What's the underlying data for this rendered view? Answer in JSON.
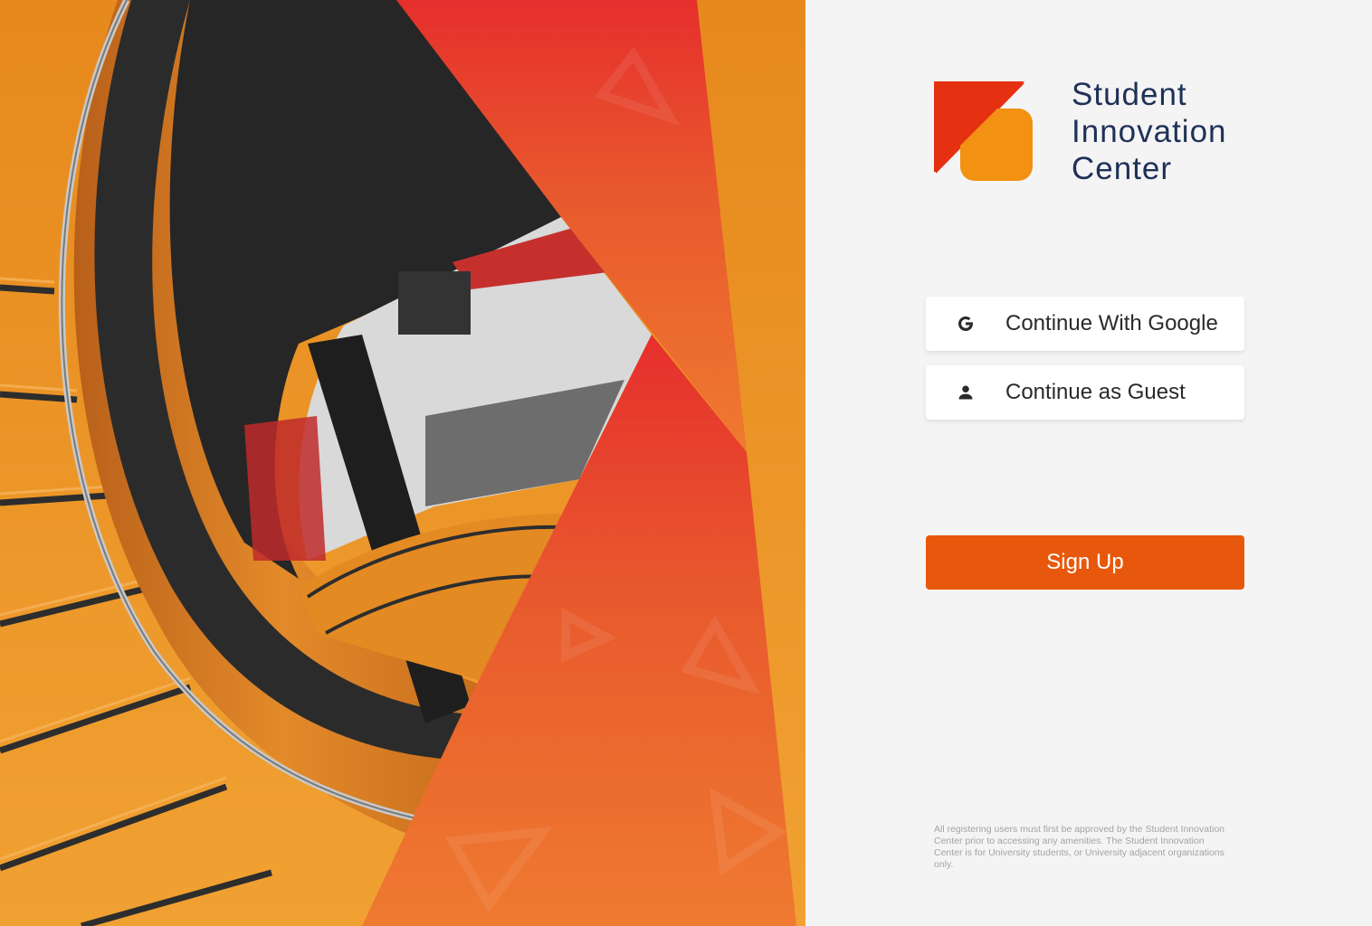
{
  "brand": {
    "name_lines": [
      "Student",
      "Innovation",
      "Center"
    ],
    "logo_icon": "sic-logo-icon",
    "colors": {
      "primary_red": "#e53012",
      "primary_orange": "#f29112",
      "navy": "#1f3158"
    }
  },
  "auth": {
    "google_label": "Continue With Google",
    "google_icon": "google-g-icon",
    "guest_label": "Continue as Guest",
    "guest_icon": "person-icon",
    "signup_label": "Sign Up",
    "signup_color": "#e8580c"
  },
  "footer": {
    "disclaimer": "All registering users must first be approved by the Student Innovation Center prior to accessing any amenities. The Student Innovation Center is for University students, or University adjacent organizations only."
  }
}
